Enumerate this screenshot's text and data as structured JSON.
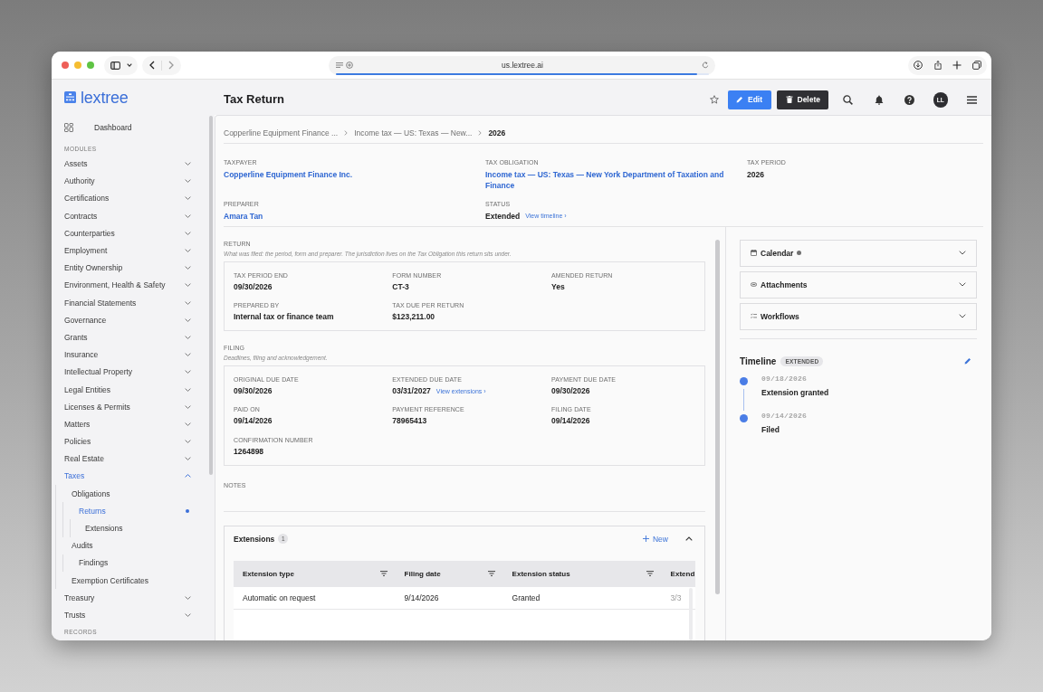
{
  "browser": {
    "url": "us.lextree.ai",
    "load": {
      "level": 0.97
    }
  },
  "sidebar": {
    "brand": "lextree",
    "dashboard": {
      "label": "Dashboard",
      "selected": false
    },
    "section_label": "MODULES",
    "items": [
      {
        "label": "Assets",
        "expanded": false,
        "selected": false
      },
      {
        "label": "Authority",
        "expanded": false,
        "selected": false
      },
      {
        "label": "Certifications",
        "expanded": false,
        "selected": false
      },
      {
        "label": "Contracts",
        "expanded": false,
        "selected": false
      },
      {
        "label": "Counterparties",
        "expanded": false,
        "selected": false
      },
      {
        "label": "Employment",
        "expanded": false,
        "selected": false
      },
      {
        "label": "Entity Ownership",
        "expanded": false,
        "selected": false
      },
      {
        "label": "Environment, Health & Safety",
        "expanded": false,
        "selected": false
      },
      {
        "label": "Financial Statements",
        "expanded": false,
        "selected": false
      },
      {
        "label": "Governance",
        "expanded": false,
        "selected": false
      },
      {
        "label": "Grants",
        "expanded": false,
        "selected": false
      },
      {
        "label": "Insurance",
        "expanded": false,
        "selected": false
      },
      {
        "label": "Intellectual Property",
        "expanded": false,
        "selected": false
      },
      {
        "label": "Legal Entities",
        "expanded": false,
        "selected": false
      },
      {
        "label": "Licenses & Permits",
        "expanded": false,
        "selected": false
      },
      {
        "label": "Matters",
        "expanded": false,
        "selected": false
      },
      {
        "label": "Policies",
        "expanded": false,
        "selected": false
      },
      {
        "label": "Real Estate",
        "expanded": false,
        "selected": false
      },
      {
        "label": "Taxes",
        "expanded": true,
        "selected": false,
        "children": [
          {
            "label": "Obligations",
            "selected": false,
            "children": [
              {
                "label": "Returns",
                "selected": true,
                "children": [
                  {
                    "label": "Extensions",
                    "selected": false
                  }
                ]
              }
            ]
          },
          {
            "label": "Audits",
            "selected": false,
            "children": [
              {
                "label": "Findings",
                "selected": false
              }
            ]
          },
          {
            "label": "Exemption Certificates",
            "selected": false
          }
        ]
      },
      {
        "label": "Treasury",
        "expanded": false,
        "selected": false
      },
      {
        "label": "Trusts",
        "expanded": false,
        "selected": false
      }
    ],
    "footer_label": "RECORDS"
  },
  "header": {
    "title": "Tax Return",
    "starred": false,
    "actions": [
      {
        "kind": "edit",
        "label": "Edit"
      },
      {
        "kind": "delete",
        "label": "Delete"
      }
    ],
    "avatar": "LL"
  },
  "breadcrumb": [
    {
      "label": "Copperline Equipment Finance ...",
      "current": false
    },
    {
      "label": "Income tax — US: Texas — New...",
      "current": false
    },
    {
      "label": "2026",
      "current": true
    }
  ],
  "summary": [
    {
      "label": "TAXPAYER",
      "value": "Copperline Equipment Finance Inc.",
      "kind": "link"
    },
    {
      "label": "TAX OBLIGATION",
      "value": "Income tax — US: Texas — New York Department of Taxation and Finance",
      "kind": "link"
    },
    {
      "label": "TAX PERIOD",
      "value": "2026",
      "kind": "text"
    },
    {
      "label": "PREPARER",
      "value": "Amara Tan",
      "kind": "link"
    },
    {
      "label": "STATUS",
      "value": "Extended",
      "kind": "text",
      "action": "View timeline ›"
    }
  ],
  "sections": [
    {
      "title": "RETURN",
      "description": "What was filed: the period, form and preparer. The jurisdiction lives on the Tax Obligation this return sits under.",
      "fields": [
        {
          "label": "TAX PERIOD END",
          "value": "09/30/2026"
        },
        {
          "label": "FORM NUMBER",
          "value": "CT-3"
        },
        {
          "label": "AMENDED RETURN",
          "value": "Yes"
        },
        {
          "label": "PREPARED BY",
          "value": "Internal tax or finance team"
        },
        {
          "label": "TAX DUE PER RETURN",
          "value": "$123,211.00"
        }
      ]
    },
    {
      "title": "FILING",
      "description": "Deadlines, filing and acknowledgement.",
      "fields": [
        {
          "label": "ORIGINAL DUE DATE",
          "value": "09/30/2026"
        },
        {
          "label": "EXTENDED DUE DATE",
          "value": "03/31/2027",
          "action": "View extensions ›"
        },
        {
          "label": "PAYMENT DUE DATE",
          "value": "09/30/2026"
        },
        {
          "label": "PAID ON",
          "value": "09/14/2026"
        },
        {
          "label": "PAYMENT REFERENCE",
          "value": "78965413"
        },
        {
          "label": "FILING DATE",
          "value": "09/14/2026"
        },
        {
          "label": "CONFIRMATION NUMBER",
          "value": "1264898"
        }
      ]
    }
  ],
  "notes": {
    "label": "NOTES"
  },
  "extensions": {
    "title": "Extensions",
    "count": "1",
    "new_label": "New",
    "expanded": true,
    "columns": [
      {
        "label": "Extension type",
        "filter": true
      },
      {
        "label": "Filing date",
        "filter": true
      },
      {
        "label": "Extension status",
        "filter": true
      },
      {
        "label": "Extend",
        "filter": false
      }
    ],
    "rows": [
      [
        "Automatic on request",
        "9/14/2026",
        "Granted",
        "3/3"
      ]
    ]
  },
  "panels": [
    {
      "title": "Calendar",
      "kind": "calendar",
      "indicator": true,
      "expanded": false
    },
    {
      "title": "Attachments",
      "kind": "attachments",
      "indicator": false,
      "expanded": false
    },
    {
      "title": "Workflows",
      "kind": "workflows",
      "indicator": false,
      "expanded": false
    }
  ],
  "timeline": {
    "title": "Timeline",
    "badge": "EXTENDED",
    "events": [
      {
        "date": "09/18/2026",
        "label": "Extension granted"
      },
      {
        "date": "09/14/2026",
        "label": "Filed"
      }
    ]
  }
}
